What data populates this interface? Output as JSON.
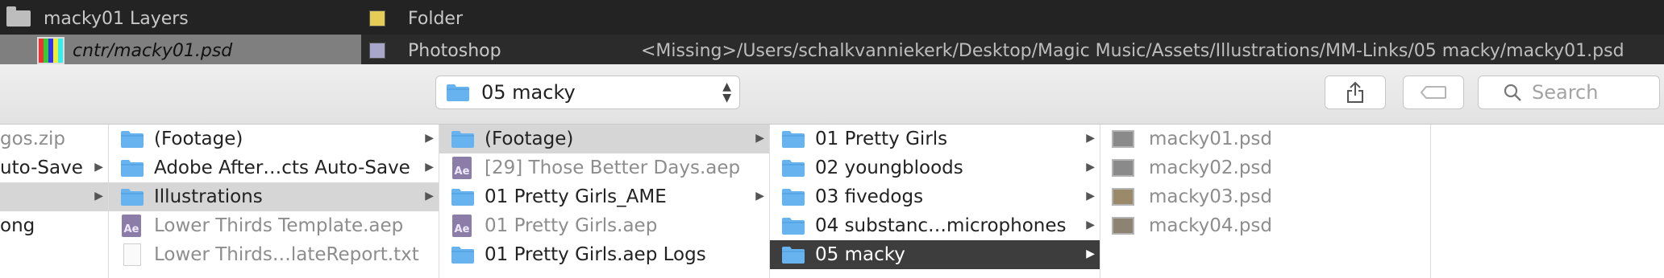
{
  "ae_panel": {
    "rows": [
      {
        "name": "macky01 Layers",
        "type": "Folder",
        "path": "",
        "swatch": "#e6cd55"
      },
      {
        "name": "cntr/macky01.psd",
        "type": "Photoshop",
        "path": "<Missing>/Users/schalkvanniekerk/Desktop/Magic Music/Assets/Illustrations/MM-Links/05 macky/macky01.psd",
        "swatch": "#a9a6cc"
      }
    ]
  },
  "toolbar": {
    "path_popup": "05 macky",
    "search_placeholder": "Search"
  },
  "columns": {
    "col0": [
      "gos.zip",
      "uto-Save",
      "",
      "ong"
    ],
    "col1": [
      "(Footage)",
      "Adobe After…cts Auto-Save",
      "Illustrations",
      "Lower Thirds Template.aep",
      "Lower Thirds…lateReport.txt"
    ],
    "col2": [
      "(Footage)",
      "[29] Those Better Days.aep",
      "01 Pretty Girls_AME",
      "01 Pretty Girls.aep",
      "01 Pretty Girls.aep Logs"
    ],
    "col3": [
      "01 Pretty Girls",
      "02 youngbloods",
      "03 fivedogs",
      "04 substanc…microphones",
      "05 macky"
    ],
    "col4": [
      "macky01.psd",
      "macky02.psd",
      "macky03.psd",
      "macky04.psd"
    ]
  },
  "colors": {
    "folder": "#66b3ef",
    "selection_dark": "#3d3d3d",
    "selection_gray": "#d6d6d6"
  }
}
